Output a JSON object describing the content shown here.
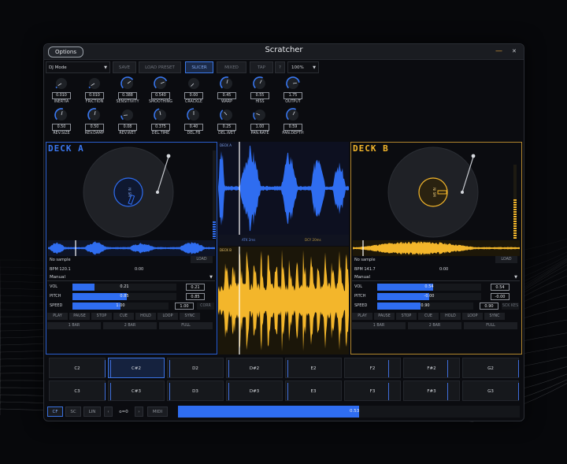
{
  "window": {
    "title": "Scratcher",
    "options_label": "Options",
    "min_glyph": "—",
    "close_glyph": "✕"
  },
  "toolbar": {
    "mode_value": "DJ Mode",
    "save": "SAVE",
    "load_preset": "LOAD PRESET",
    "slicer": "SLICER",
    "mixed": "MIXED",
    "tap": "TAP",
    "help": "?",
    "zoom_value": "100%"
  },
  "knobs_row1": [
    {
      "label": "INERTIA",
      "value": "0.010",
      "level": 0.05
    },
    {
      "label": "FRICTION",
      "value": "0.010",
      "level": 0.05
    },
    {
      "label": "SENSITIVITY",
      "value": "0.388",
      "level": 0.7
    },
    {
      "label": "SMOOTHING",
      "value": "0.540",
      "level": 0.75
    },
    {
      "label": "CRACKLE",
      "value": "0.00",
      "level": 0.0
    },
    {
      "label": "WARP",
      "value": "0.45",
      "level": 0.55
    },
    {
      "label": "HISS",
      "value": "0.55",
      "level": 0.6
    },
    {
      "label": "OUTPUT",
      "value": "1.75",
      "level": 0.8
    }
  ],
  "knobs_row2": [
    {
      "label": "REV.SIZE",
      "value": "0.50",
      "level": 0.55
    },
    {
      "label": "REV.DAMP",
      "value": "0.50",
      "level": 0.55
    },
    {
      "label": "REV.WET",
      "value": "0.08",
      "level": 0.15
    },
    {
      "label": "DEL.TIME",
      "value": "0.375",
      "level": 0.45
    },
    {
      "label": "DEL.FB",
      "value": "0.40",
      "level": 0.5
    },
    {
      "label": "DEL.WET",
      "value": "0.25",
      "level": 0.35
    },
    {
      "label": "PAN.RATE",
      "value": "1.00",
      "level": 0.25
    },
    {
      "label": "PAN.DEPTH",
      "value": "0.59",
      "level": 0.6
    }
  ],
  "deck_a": {
    "title": "DECK A",
    "label_text": "NI SM",
    "sample": "No sample",
    "load": "LOAD",
    "bpm": "BPM 120.1",
    "time": "0:00",
    "mode": "Manual",
    "vol_label": "VOL",
    "vol_value": "0.21",
    "vol_box": "0.21",
    "vol_level": 0.21,
    "pitch_label": "PITCH",
    "pitch_value": "0.85",
    "pitch_box": "0.85",
    "pitch_level": 0.52,
    "speed_label": "SPEED",
    "speed_value": "1.00",
    "speed_box": "1.00",
    "speed_level": 0.5,
    "extra": "CORR",
    "transport": [
      "PLAY",
      "PAUSE",
      "STOP",
      "CUE",
      "HOLD",
      "LOOP",
      "SYNC"
    ],
    "lengths": [
      "1 BAR",
      "2 BAR",
      "FULL"
    ],
    "accent": "#2f6df0"
  },
  "deck_b": {
    "title": "DECK B",
    "label_text": "NI SM",
    "sample": "No sample",
    "load": "LOAD",
    "bpm": "BPM 141.7",
    "time": "0:00",
    "mode": "Manual",
    "vol_label": "VOL",
    "vol_value": "0.54",
    "vol_box": "0.54",
    "vol_level": 0.54,
    "pitch_label": "PITCH",
    "pitch_value": "-0.00",
    "pitch_box": "-0.00",
    "pitch_level": 0.5,
    "speed_label": "SPEED",
    "speed_value": "0.90",
    "speed_box": "0.90",
    "speed_level": 0.45,
    "extra": "SCK KES",
    "transport": [
      "PLAY",
      "PAUSE",
      "STOP",
      "CUE",
      "HOLD",
      "LOOP",
      "SYNC"
    ],
    "lengths": [
      "1 BAR",
      "2 BAR",
      "FULL"
    ],
    "accent": "#f3b62b"
  },
  "center": {
    "deck_a_tag": "DECK A",
    "deck_b_tag": "DECK B",
    "lat_a": "ATK 2ms",
    "lat_b": "DCY 20ms"
  },
  "pads": {
    "row1": [
      "C2",
      "C#2",
      "D2",
      "D#2",
      "E2",
      "F2",
      "F#2",
      "G2"
    ],
    "row2": [
      "C3",
      "C#3",
      "D3",
      "D#3",
      "E3",
      "F3",
      "F#3",
      "G3"
    ],
    "active": "C#2"
  },
  "bottom": {
    "cf": "CF",
    "sc": "SC",
    "lin": "LIN",
    "prev": "‹",
    "octave": "o=0",
    "next": "›",
    "midi": "MIDI",
    "crossfader_value": "0.53",
    "crossfader_level": 0.53
  },
  "colors": {
    "blue": "#2f6df0",
    "gold": "#f3b62b",
    "bg": "#0b0c10"
  }
}
